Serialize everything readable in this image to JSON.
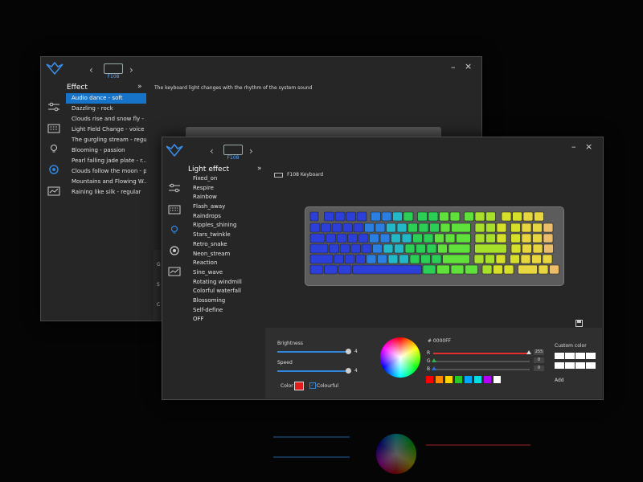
{
  "back_window": {
    "model": "F108",
    "controls": {
      "min": "–",
      "close": "×"
    },
    "effect_title": "Effect",
    "expand": "»",
    "description": "The keyboard light changes with the rhythm of the system sound",
    "effects": [
      "Audio dance - soft",
      "Dazzling - rock",
      "Clouds rise and snow fly - ...",
      "Light Field Change - voice",
      "The gurgling stream - regu...",
      "Blooming - passion",
      "Pearl falling jade plate - r...",
      "Clouds follow the moon - p...",
      "Mountains and Flowing W...",
      "Raining like silk - regular"
    ],
    "partial_labels": [
      "G",
      "S",
      "C"
    ]
  },
  "front_window": {
    "model": "F108",
    "controls": {
      "min": "–",
      "close": "×"
    },
    "light_effect_title": "Light effect",
    "expand": "»",
    "keyboard_label": "F108 Keyboard",
    "effects": [
      "Fixed_on",
      "Respire",
      "Rainbow",
      "Flash_away",
      "Raindrops",
      "Ripples_shining",
      "Stars_twinkle",
      "Retro_snake",
      "Neon_stream",
      "Reaction",
      "Sine_wave",
      "Rotating windmill",
      "Colorful waterfall",
      "Blossoming",
      "Self-define",
      "OFF"
    ],
    "brightness_label": "Brightness",
    "brightness_value": "4",
    "brightness_level": 1.0,
    "speed_label": "Speed",
    "speed_value": "4",
    "speed_level": 1.0,
    "color_label": "Color",
    "colorful_label": "Colourful",
    "selected_color": "#e21b1b",
    "hex_value": "# 0000FF",
    "rgb": [
      {
        "label": "R",
        "value": "255",
        "color": "#e23030"
      },
      {
        "label": "G",
        "value": "0",
        "color": "#2fb344"
      },
      {
        "label": "B",
        "value": "0",
        "color": "#2e6cde"
      }
    ],
    "palette": [
      "#ff0000",
      "#ff8a00",
      "#ffd400",
      "#26c926",
      "#00a8ff",
      "#00e0e0",
      "#b400ff",
      "#ffffff"
    ],
    "custom_color_label": "Custom color",
    "add_label": "Add"
  },
  "accent": "#1773c8"
}
